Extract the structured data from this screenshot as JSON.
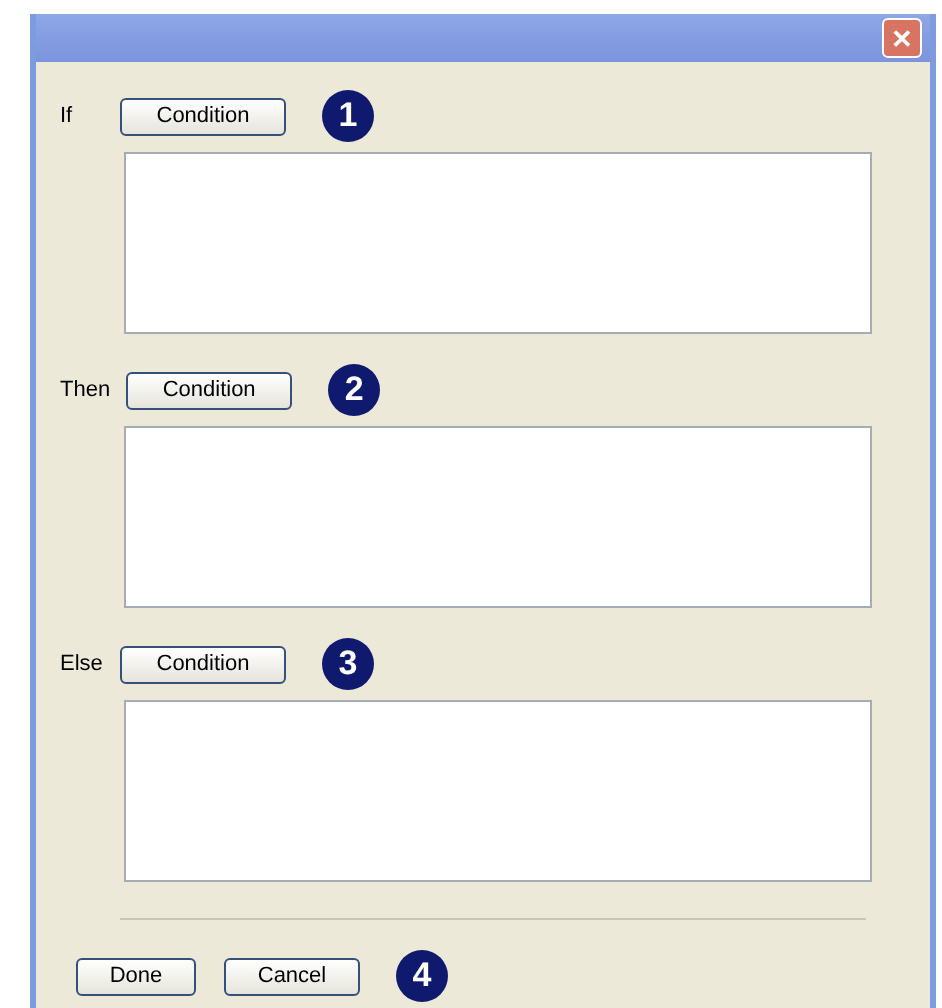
{
  "window": {
    "close_button": "✕"
  },
  "sections": [
    {
      "label": "If",
      "button": "Condition",
      "step": "1"
    },
    {
      "label": "Then",
      "button": "Condition",
      "step": "2"
    },
    {
      "label": "Else",
      "button": "Condition",
      "step": "3"
    }
  ],
  "footer": {
    "buttons": [
      "Done",
      "Cancel"
    ],
    "step": "4"
  }
}
